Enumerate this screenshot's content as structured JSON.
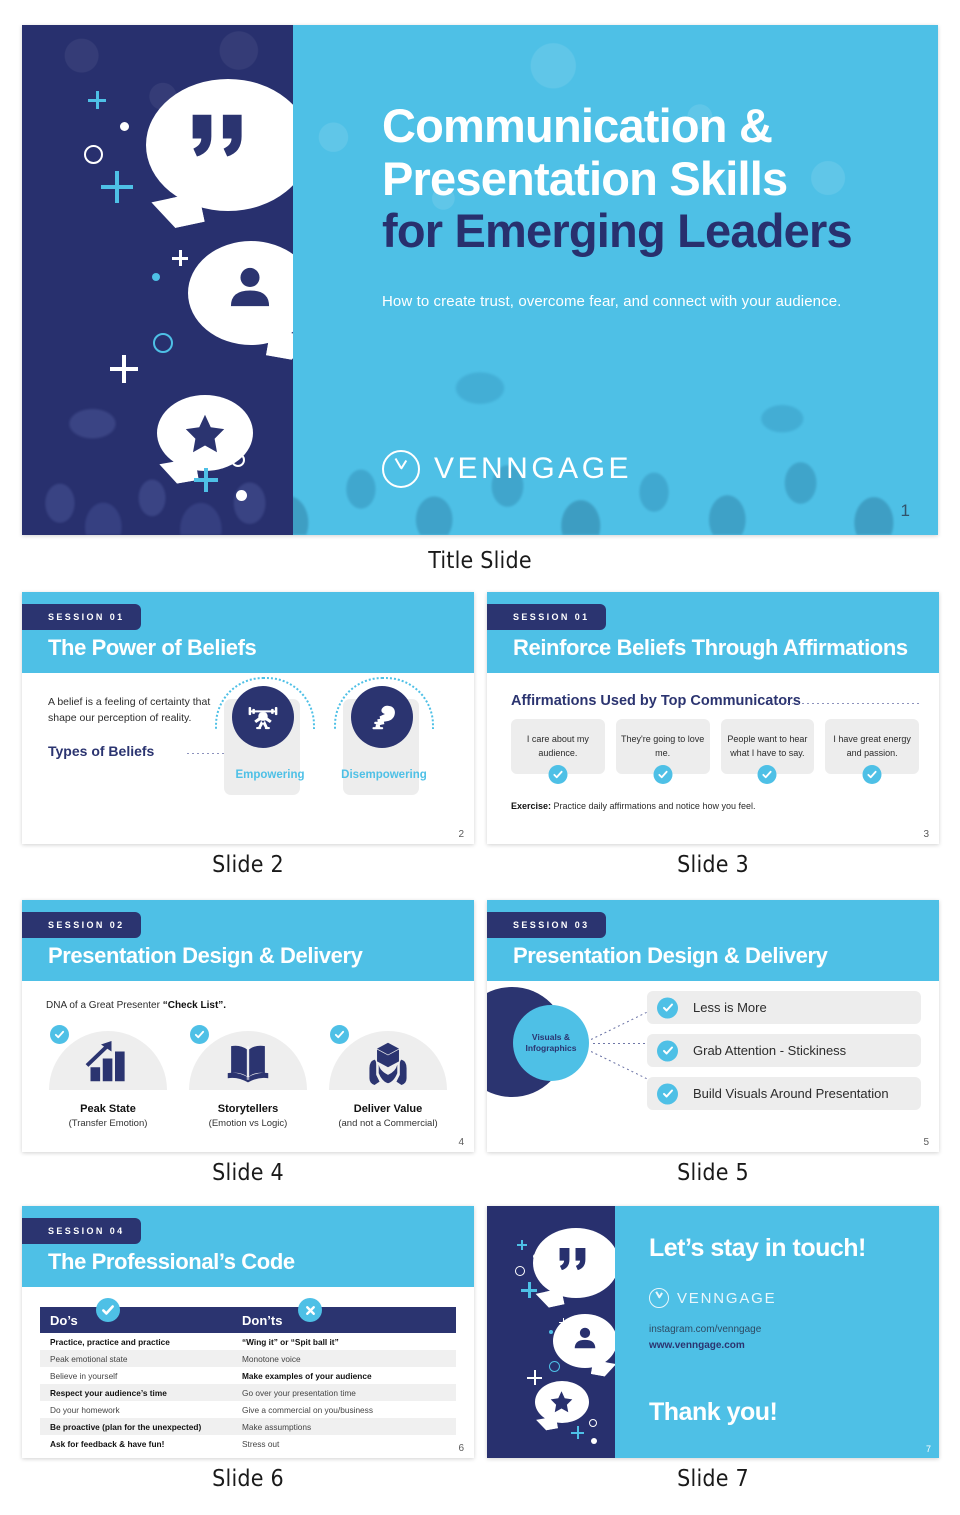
{
  "brand": {
    "cyan": "#4ec0e6",
    "navy": "#2b3470",
    "gray_card": "#ededed",
    "name": "VENNGAGE"
  },
  "title_slide": {
    "caption": "Title Slide",
    "line1": "Communication &",
    "line2": "Presentation Skills",
    "line3": "for Emerging Leaders",
    "subtitle": "How to create trust, overcome fear, and connect with your audience.",
    "logo": "VENNGAGE",
    "page_number": "1",
    "icons": [
      "quote-bubble-icon",
      "person-bubble-icon",
      "star-bubble-icon"
    ]
  },
  "slide2": {
    "caption": "Slide 2",
    "session": "SESSION 01",
    "title": "The Power of Beliefs",
    "paragraph": "A belief is a feeling of certainty that shape our perception of reality.",
    "subhead": "Types of Beliefs",
    "cards": [
      {
        "label": "Empowering",
        "icon": "weightlifter-icon"
      },
      {
        "label": "Disempowering",
        "icon": "hand-pressing-down-icon"
      }
    ],
    "page_number": "2"
  },
  "slide3": {
    "caption": "Slide 3",
    "session": "SESSION 01",
    "title": "Reinforce Beliefs Through Affirmations",
    "subhead": "Affirmations Used by Top Communicators",
    "affirmations": [
      "I care about my audience.",
      "They're going to love me.",
      "People want to hear what I have to say.",
      "I have great energy and passion."
    ],
    "exercise_label": "Exercise:",
    "exercise_text": " Practice daily affirmations and notice how you feel.",
    "page_number": "3"
  },
  "slide4": {
    "caption": "Slide 4",
    "session": "SESSION 02",
    "title": "Presentation Design & Delivery",
    "intro_plain": "DNA of a Great Presenter ",
    "intro_bold": "“Check List”.",
    "columns": [
      {
        "title": "Peak State",
        "subtitle": "(Transfer Emotion)",
        "icon": "bar-chart-growth-icon"
      },
      {
        "title": "Storytellers",
        "subtitle": "(Emotion vs Logic)",
        "icon": "open-book-icon"
      },
      {
        "title": "Deliver Value",
        "subtitle": "(and not a Commercial)",
        "icon": "hands-holding-box-icon"
      }
    ],
    "page_number": "4"
  },
  "slide5": {
    "caption": "Slide 5",
    "session": "SESSION 03",
    "title": "Presentation Design & Delivery",
    "hub_line1": "Visuals &",
    "hub_line2": "Infographics",
    "items": [
      "Less is More",
      "Grab Attention - Stickiness",
      "Build Visuals Around Presentation"
    ],
    "page_number": "5"
  },
  "slide6": {
    "caption": "Slide 6",
    "session": "SESSION 04",
    "title": "The Professional’s Code",
    "col1_header": "Do’s",
    "col2_header": "Don’ts",
    "col1_badge": "check-icon",
    "col2_badge": "cross-icon",
    "rows": [
      {
        "do": "Practice, practice and practice",
        "do_bold": true,
        "dont": "“Wing it” or “Spit ball it”",
        "dont_bold": true
      },
      {
        "do": "Peak emotional state",
        "do_bold": false,
        "dont": "Monotone voice",
        "dont_bold": false
      },
      {
        "do": "Believe in yourself",
        "do_bold": false,
        "dont": "Make examples of your audience",
        "dont_bold": true
      },
      {
        "do": "Respect your audience’s time",
        "do_bold": true,
        "dont": "Go over your presentation time",
        "dont_bold": false
      },
      {
        "do": "Do your homework",
        "do_bold": false,
        "dont": "Give a commercial on you/business",
        "dont_bold": false
      },
      {
        "do": "Be proactive (plan for the unexpected)",
        "do_bold": true,
        "dont": "Make assumptions",
        "dont_bold": false
      },
      {
        "do": "Ask for feedback & have fun!",
        "do_bold": true,
        "dont": "Stress out",
        "dont_bold": false
      }
    ],
    "page_number": "6"
  },
  "slide7": {
    "caption": "Slide 7",
    "heading": "Let’s stay in touch!",
    "logo": "VENNGAGE",
    "instagram": "instagram.com/venngage",
    "website": "www.venngage.com",
    "thanks": "Thank you!",
    "page_number": "7",
    "icons": [
      "quote-bubble-icon",
      "person-bubble-icon",
      "star-bubble-icon"
    ]
  }
}
